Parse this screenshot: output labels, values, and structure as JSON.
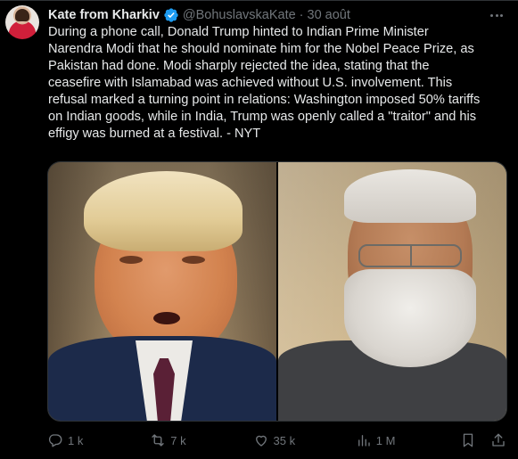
{
  "author": {
    "name": "Kate from Kharkiv",
    "handle": "@BohuslavskaKate",
    "separator": "·",
    "date": "30 août"
  },
  "tweet": {
    "text": "During a phone call, Donald Trump hinted to Indian Prime Minister\nNarendra Modi that he should nominate him for the Nobel Peace Prize, as\nPakistan had done. Modi sharply rejected the idea, stating that the\nceasefire with Islamabad was achieved without U.S. involvement. This\nrefusal marked a turning point in relations: Washington imposed 50% tariffs\non Indian goods, while in India, Trump was openly called a \"traitor\" and his\neffigy was burned at a festival. - NYT"
  },
  "icons": {
    "verified": "verified-badge-icon",
    "more": "more-options-icon",
    "reply": "reply-icon",
    "retweet": "retweet-icon",
    "like": "heart-icon",
    "views": "views-chart-icon",
    "bookmark": "bookmark-icon",
    "share": "share-icon"
  },
  "actions": {
    "replies": "1 k",
    "retweets": "7 k",
    "likes": "35 k",
    "views": "1 M"
  },
  "colors": {
    "background": "#000000",
    "text": "#e7e9ea",
    "muted": "#71767b",
    "verified": "#1d9bf0"
  }
}
